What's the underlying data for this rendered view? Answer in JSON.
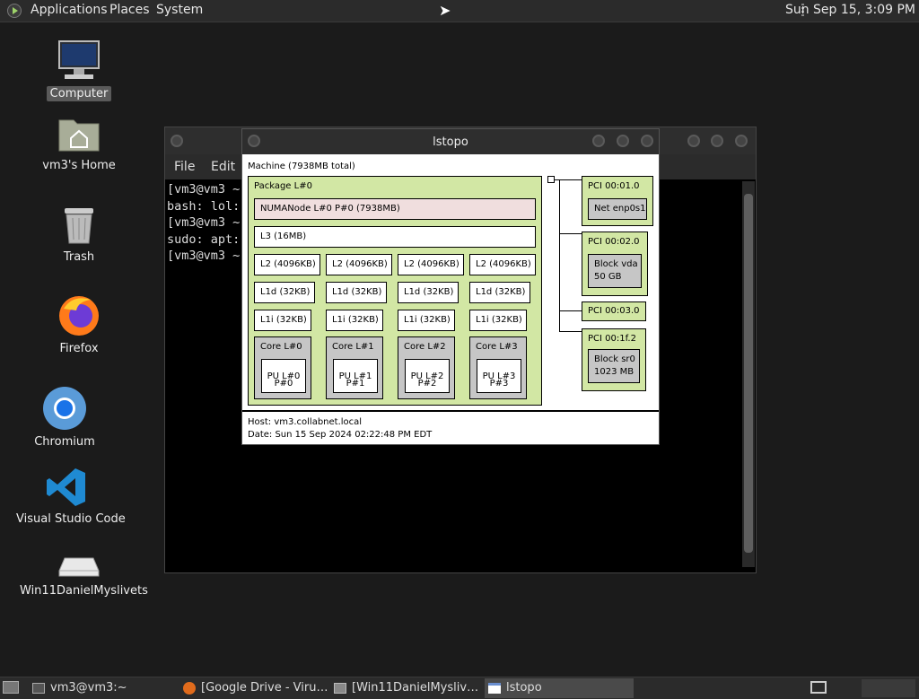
{
  "top_panel": {
    "menus": [
      "Applications",
      "Places",
      "System"
    ],
    "clock": "Sun Sep 15,  3:09 PM"
  },
  "desktop_icons": [
    {
      "label": "Computer",
      "icon": "computer-icon"
    },
    {
      "label": "vm3's Home",
      "icon": "home-folder-icon"
    },
    {
      "label": "Trash",
      "icon": "trash-icon"
    },
    {
      "label": "Firefox",
      "icon": "firefox-icon"
    },
    {
      "label": "Chromium",
      "icon": "chromium-icon"
    },
    {
      "label": "Visual Studio Code",
      "icon": "vscode-icon"
    },
    {
      "label": "Win11DanielMyslivets",
      "icon": "drive-icon"
    }
  ],
  "terminal": {
    "menu": [
      "File",
      "Edit"
    ],
    "lines": [
      "[vm3@vm3 ~",
      "bash: lol:",
      "[vm3@vm3 ~",
      "sudo: apt:",
      "[vm3@vm3 ~"
    ]
  },
  "lstopo": {
    "title": "lstopo",
    "machine": "Machine (7938MB total)",
    "package": "Package L#0",
    "numa": "NUMANode L#0 P#0 (7938MB)",
    "l3": "L3 (16MB)",
    "l2": [
      "L2 (4096KB)",
      "L2 (4096KB)",
      "L2 (4096KB)",
      "L2 (4096KB)"
    ],
    "l1d": [
      "L1d (32KB)",
      "L1d (32KB)",
      "L1d (32KB)",
      "L1d (32KB)"
    ],
    "l1i": [
      "L1i (32KB)",
      "L1i (32KB)",
      "L1i (32KB)",
      "L1i (32KB)"
    ],
    "cores": [
      {
        "core": "Core L#0",
        "pu1": "PU L#0",
        "pu2": "P#0"
      },
      {
        "core": "Core L#1",
        "pu1": "PU L#1",
        "pu2": "P#1"
      },
      {
        "core": "Core L#2",
        "pu1": "PU L#2",
        "pu2": "P#2"
      },
      {
        "core": "Core L#3",
        "pu1": "PU L#3",
        "pu2": "P#3"
      }
    ],
    "pci": [
      {
        "label": "PCI 00:01.0",
        "dev1": "Net enp0s1",
        "dev2": ""
      },
      {
        "label": "PCI 00:02.0",
        "dev1": "Block vda",
        "dev2": "50 GB"
      },
      {
        "label": "PCI 00:03.0",
        "dev1": "",
        "dev2": ""
      },
      {
        "label": "PCI 00:1f.2",
        "dev1": "Block sr0",
        "dev2": "1023 MB"
      }
    ],
    "host": "Host: vm3.collabnet.local",
    "date": "Date: Sun 15 Sep 2024 02:22:48 PM EDT"
  },
  "taskbar": {
    "tasks": [
      {
        "label": "vm3@vm3:~",
        "icon": "terminal-icon"
      },
      {
        "label": "[Google Drive - Viru…",
        "icon": "firefox-icon"
      },
      {
        "label": "[Win11DanielMysliv…",
        "icon": "vm-icon"
      },
      {
        "label": "lstopo",
        "icon": "window-icon"
      }
    ]
  }
}
